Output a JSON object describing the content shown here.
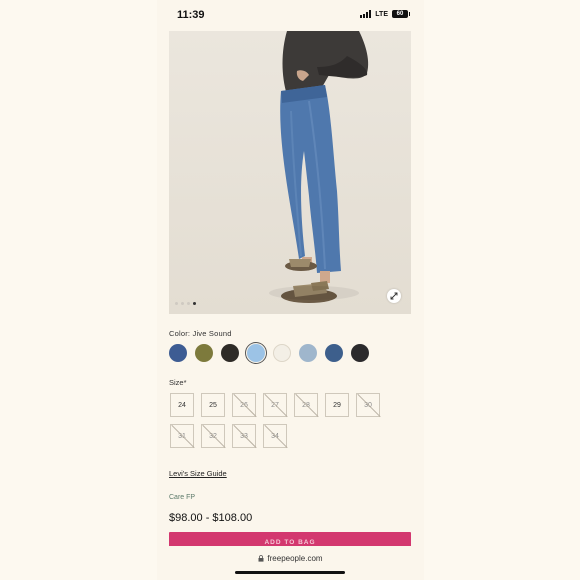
{
  "status": {
    "time": "11:39",
    "network": "LTE",
    "battery": "60"
  },
  "gallery": {
    "image_count": 4,
    "active_index": 3
  },
  "color": {
    "label": "Color: Jive Sound",
    "selected_index": 3,
    "swatches": [
      {
        "name": "dark-indigo-swatch",
        "hex": "#3d5c93"
      },
      {
        "name": "olive-swatch",
        "hex": "#7d7a3c"
      },
      {
        "name": "black-swatch",
        "hex": "#2e2b27"
      },
      {
        "name": "light-blue-swatch",
        "hex": "#9cc3e6"
      },
      {
        "name": "cream-swatch",
        "hex": "#f3efe6"
      },
      {
        "name": "pale-blue-swatch",
        "hex": "#9fb6cc"
      },
      {
        "name": "medium-blue-swatch",
        "hex": "#3d5f8c"
      },
      {
        "name": "charcoal-swatch",
        "hex": "#2b2a2c"
      }
    ]
  },
  "size": {
    "label": "Size*",
    "options": [
      {
        "label": "24",
        "available": true
      },
      {
        "label": "25",
        "available": true
      },
      {
        "label": "26",
        "available": false
      },
      {
        "label": "27",
        "available": false
      },
      {
        "label": "28",
        "available": false
      },
      {
        "label": "29",
        "available": true
      },
      {
        "label": "30",
        "available": false
      },
      {
        "label": "31",
        "available": false
      },
      {
        "label": "32",
        "available": false
      },
      {
        "label": "33",
        "available": false
      },
      {
        "label": "34",
        "available": false
      }
    ]
  },
  "links": {
    "size_guide": "Levi's Size Guide"
  },
  "care_label": "Care FP",
  "price": "$98.00 - $108.00",
  "add_to_bag": "ADD TO BAG",
  "browser": {
    "url": "freepeople.com"
  }
}
